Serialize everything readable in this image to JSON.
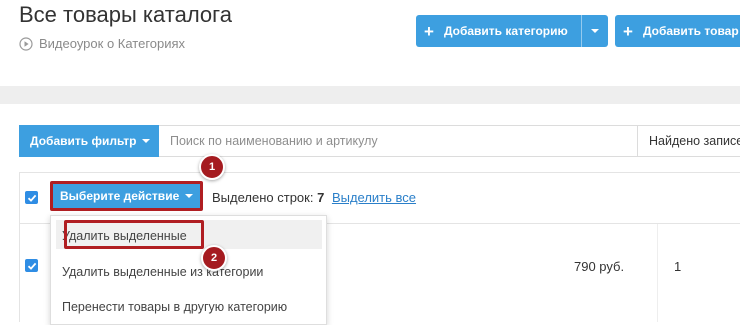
{
  "header": {
    "title": "Все товары каталога",
    "video_link": "Видеоурок о Категориях",
    "add_category_label": "Добавить категорию",
    "add_product_label": "Добавить товар"
  },
  "filter_bar": {
    "add_filter_label": "Добавить фильтр",
    "search_placeholder": "Поиск по наименованию и артикулу",
    "found_text": "Найдено записей"
  },
  "bulk_actions": {
    "action_button_label": "Выберите действие",
    "selected_prefix": "Выделено строк:",
    "selected_count": "7",
    "select_all_link": "Выделить все",
    "menu_items": [
      "Удалить выделенные",
      "Удалить выделенные из категории",
      "Перенести товары в другую категорию"
    ]
  },
  "table": {
    "rows": [
      {
        "price": "790 руб.",
        "quantity": "1",
        "checked": true
      }
    ]
  },
  "annotations": {
    "step_1": "1",
    "step_2": "2"
  },
  "colors": {
    "primary": "#3d9fe0",
    "checkbox": "#2f8de4",
    "highlight": "#b01e22",
    "link": "#2a7fc9"
  }
}
